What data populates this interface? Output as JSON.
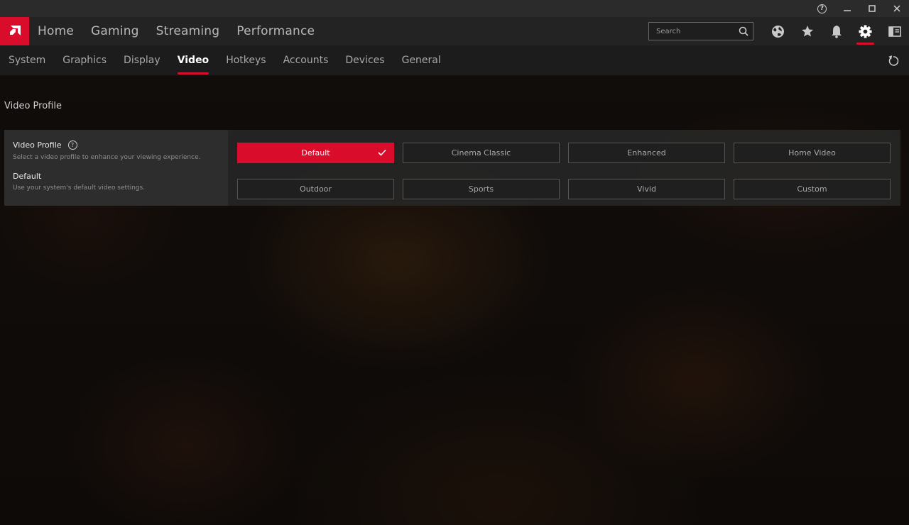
{
  "colors": {
    "accent": "#d90d2b",
    "header_bg": "#232323",
    "subnav_bg": "#1c1c1c"
  },
  "titlebar": {
    "icons": [
      "help-icon",
      "minimize-icon",
      "maximize-icon",
      "close-icon"
    ]
  },
  "header": {
    "nav": [
      "Home",
      "Gaming",
      "Streaming",
      "Performance"
    ],
    "search_placeholder": "Search",
    "icons": [
      "globe-icon",
      "star-icon",
      "bell-icon",
      "gear-icon",
      "sidebar-panel-icon"
    ],
    "active_icon": "gear-icon"
  },
  "subnav": {
    "tabs": [
      "System",
      "Graphics",
      "Display",
      "Video",
      "Hotkeys",
      "Accounts",
      "Devices",
      "General"
    ],
    "active": "Video"
  },
  "section": {
    "title": "Video Profile"
  },
  "panel": {
    "title": "Video Profile",
    "description": "Select a video profile to enhance your viewing experience.",
    "selected_name": "Default",
    "selected_description": "Use your system's default video settings.",
    "options": [
      "Default",
      "Cinema Classic",
      "Enhanced",
      "Home Video",
      "Outdoor",
      "Sports",
      "Vivid",
      "Custom"
    ],
    "selected": "Default"
  }
}
